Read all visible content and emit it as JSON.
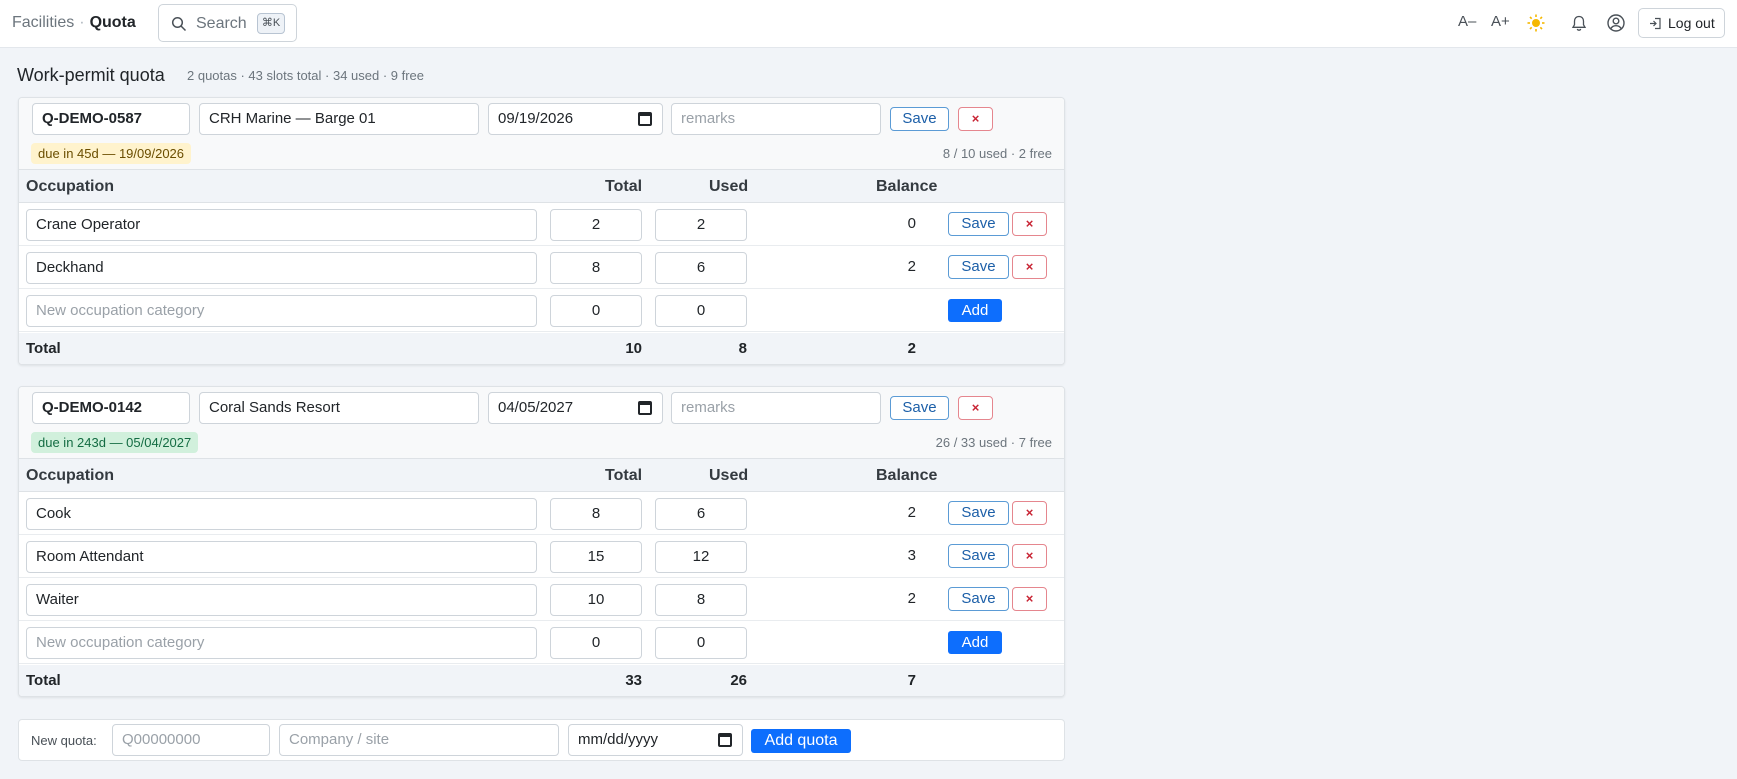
{
  "nav": {
    "parent": "Facilities",
    "separator": "·",
    "current": "Quota",
    "search_label": "Search",
    "search_shortcut": "⌘K",
    "font_smaller": "A–",
    "font_larger": "A+",
    "theme_icon": "sun-icon",
    "logout": "Log out"
  },
  "page": {
    "title": "Work-permit quota",
    "summary": "2 quotas · 43 slots total · 34 used · 9 free"
  },
  "columns": {
    "occupation": "Occupation",
    "total": "Total",
    "used": "Used",
    "balance": "Balance"
  },
  "buttons": {
    "save": "Save",
    "delete": "×",
    "add": "Add",
    "add_quota": "Add quota"
  },
  "new_row": {
    "placeholder": "New occupation category",
    "total": "0",
    "used": "0"
  },
  "remarks_placeholder": "remarks",
  "total_label": "Total",
  "quotas": [
    {
      "id": "Q-DEMO-0587",
      "company": "CRH Marine — Barge 01",
      "date": "09/19/2026",
      "due": "due in 45d — 19/09/2026",
      "usage": "8 / 10 used · 2 free",
      "rows": [
        {
          "occupation": "Crane Operator",
          "total": "2",
          "used": "2",
          "balance": "0"
        },
        {
          "occupation": "Deckhand",
          "total": "8",
          "used": "6",
          "balance": "2"
        }
      ],
      "totals": {
        "total": "10",
        "used": "8",
        "balance": "2"
      }
    },
    {
      "id": "Q-DEMO-0142",
      "company": "Coral Sands Resort",
      "date": "04/05/2027",
      "due": "due in 243d — 05/04/2027",
      "usage": "26 / 33 used · 7 free",
      "rows": [
        {
          "occupation": "Cook",
          "total": "8",
          "used": "6",
          "balance": "2"
        },
        {
          "occupation": "Room Attendant",
          "total": "15",
          "used": "12",
          "balance": "3"
        },
        {
          "occupation": "Waiter",
          "total": "10",
          "used": "8",
          "balance": "2"
        }
      ],
      "totals": {
        "total": "33",
        "used": "26",
        "balance": "7"
      }
    }
  ],
  "new_quota": {
    "label": "New quota:",
    "id_placeholder": "Q00000000",
    "company_placeholder": "Company / site",
    "date_placeholder": "mm/dd/yyyy"
  },
  "colors": {
    "accent": "#0d6efd",
    "danger": "#c82333",
    "warn_bg": "#fff3cd",
    "ok_bg": "#d1f0dc"
  }
}
